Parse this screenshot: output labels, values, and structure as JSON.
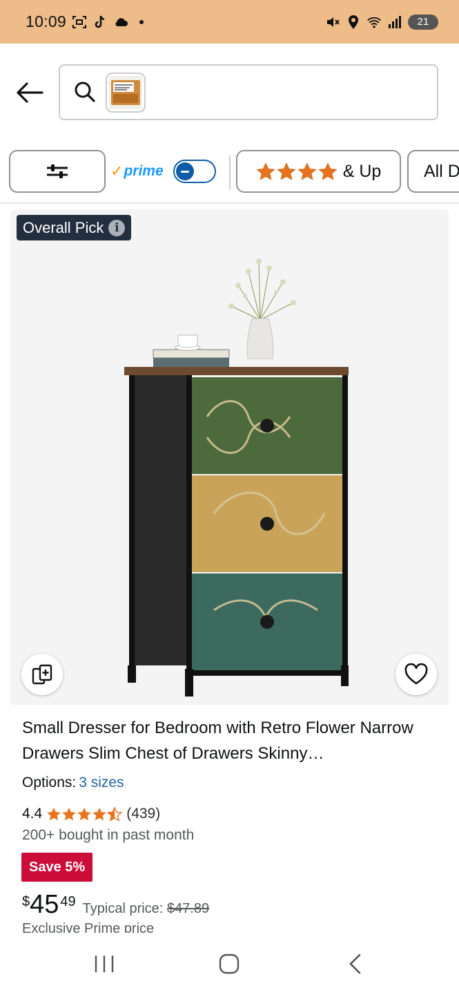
{
  "status_bar": {
    "time": "10:09",
    "battery": "21",
    "icons_left": [
      "screenshot-icon",
      "tiktok-icon",
      "cloud-icon",
      "dot-icon"
    ],
    "icons_right": [
      "mute-icon",
      "location-icon",
      "wifi-icon",
      "signal-icon",
      "battery-icon"
    ]
  },
  "header": {
    "back_icon": "arrow-left-icon",
    "search_icon": "search-icon",
    "search_image": "search-thumbnail"
  },
  "filters": {
    "filter_icon": "sliders-icon",
    "prime_label": "prime",
    "prime_toggle_on": false,
    "stars_rating": 4,
    "stars_suffix": "& Up",
    "department_label": "All D"
  },
  "product": {
    "badge": "Overall Pick",
    "badge_info_glyph": "i",
    "title": "Small Dresser for Bedroom with Retro Flower Narrow Drawers Slim Chest of Drawers Skinny…",
    "options_label": "Options:",
    "options_value": "3 sizes",
    "rating_value": "4.4",
    "rating_stars": 4.4,
    "reviews": "(439)",
    "bought": "200+ bought in past month",
    "save_badge": "Save 5%",
    "price_currency": "$",
    "price_whole": "45",
    "price_fraction": "49",
    "typical_label": "Typical price:",
    "typical_price": "$47.89",
    "exclusive": "Exclusive Prime price"
  },
  "colors": {
    "status_bar_bg": "#eebc88",
    "badge_bg": "#232f3e",
    "link": "#2162a1",
    "save_bg": "#cc0c39",
    "star": "#e8731c",
    "prime_blue": "#1a98ff"
  },
  "navbar": {
    "items": [
      "recent-apps-icon",
      "home-icon",
      "back-nav-icon"
    ]
  }
}
